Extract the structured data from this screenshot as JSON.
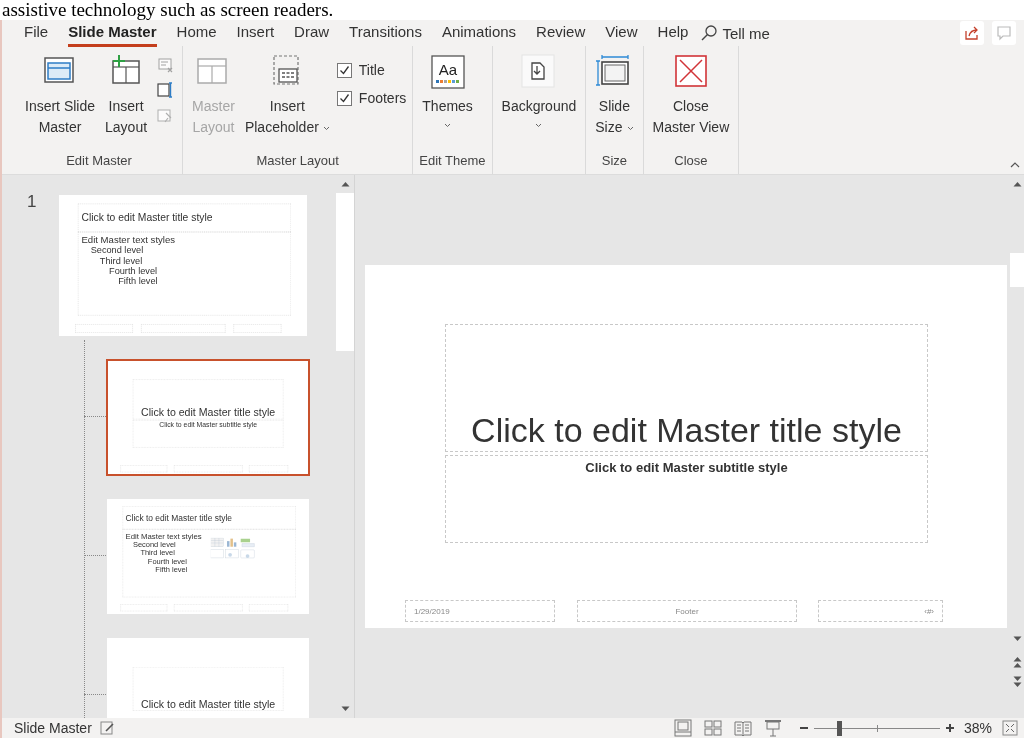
{
  "document_text": "assistive technology such as screen readers.",
  "tabs": [
    {
      "label": "File",
      "selected": false
    },
    {
      "label": "Slide Master",
      "selected": true
    },
    {
      "label": "Home",
      "selected": false
    },
    {
      "label": "Insert",
      "selected": false
    },
    {
      "label": "Draw",
      "selected": false
    },
    {
      "label": "Transitions",
      "selected": false
    },
    {
      "label": "Animations",
      "selected": false
    },
    {
      "label": "Review",
      "selected": false
    },
    {
      "label": "View",
      "selected": false
    },
    {
      "label": "Help",
      "selected": false
    }
  ],
  "tell_me": "Tell me",
  "ribbon_groups": [
    {
      "label": "Edit Master",
      "items": [
        {
          "kind": "large",
          "label": "Insert Slide\nMaster",
          "disabled": false
        },
        {
          "kind": "large",
          "label": "Insert\nLayout",
          "disabled": false
        },
        {
          "kind": "stack",
          "buttons": [
            {
              "disabled": true
            },
            {
              "disabled": false
            },
            {
              "disabled": true
            }
          ]
        }
      ]
    },
    {
      "label": "Master Layout",
      "items": [
        {
          "kind": "large",
          "label": "Master\nLayout",
          "disabled": true
        },
        {
          "kind": "large",
          "label": "Insert\nPlaceholder",
          "disabled": false,
          "dropdown": true
        },
        {
          "kind": "checkboxes",
          "options": [
            {
              "label": "Title",
              "checked": true
            },
            {
              "label": "Footers",
              "checked": true
            }
          ]
        }
      ]
    },
    {
      "label": "Edit Theme",
      "items": [
        {
          "kind": "large",
          "label": "Themes",
          "icon_text": "Aa",
          "disabled": false,
          "dropdown": true,
          "caret_below": true
        }
      ]
    },
    {
      "items": [
        {
          "kind": "large",
          "label": "Background",
          "disabled": false,
          "dropdown": true,
          "caret_below": true
        }
      ]
    },
    {
      "label": "Size",
      "items": [
        {
          "kind": "large",
          "label": "Slide\nSize",
          "disabled": false,
          "dropdown": true
        }
      ]
    },
    {
      "label": "Close",
      "items": [
        {
          "kind": "large",
          "label": "Close\nMaster View",
          "disabled": false
        }
      ]
    }
  ],
  "slides_panel": {
    "slides": [
      {
        "number": "1",
        "kind": "master",
        "selected": false,
        "title": "Click to edit Master title style",
        "body": [
          {
            "text": "Edit Master text styles",
            "children": [
              {
                "text": "Second level",
                "children": [
                  {
                    "text": "Third level",
                    "children": [
                      {
                        "text": "Fourth level",
                        "children": [
                          {
                            "text": "Fifth level"
                          }
                        ]
                      }
                    ]
                  }
                ]
              }
            ]
          }
        ]
      },
      {
        "kind": "title",
        "selected": true,
        "title": "Click to edit Master title style",
        "subtitle": "Click to edit Master subtitle style"
      },
      {
        "kind": "content",
        "selected": false,
        "title": "Click to edit Master title style",
        "body": [
          {
            "text": "Edit Master text styles",
            "children": [
              {
                "text": "Second level",
                "children": [
                  {
                    "text": "Third level",
                    "children": [
                      {
                        "text": "Fourth level",
                        "children": [
                          {
                            "text": "Fifth level"
                          }
                        ]
                      }
                    ]
                  }
                ]
              }
            ]
          }
        ]
      },
      {
        "kind": "section",
        "selected": false,
        "title": "Click to edit Master title style"
      }
    ]
  },
  "slide_editor": {
    "kind": "title",
    "title": "Click to edit Master title style",
    "subtitle": "Click to edit Master subtitle style",
    "footers": [
      "1/29/2019",
      "Footer",
      "‹#›"
    ]
  },
  "status_bar": {
    "mode": "Slide Master",
    "zoom": {
      "level": 0.18
    },
    "zoom_text": "38%"
  }
}
